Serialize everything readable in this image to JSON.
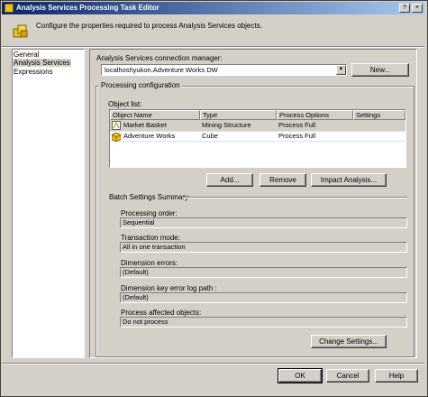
{
  "window": {
    "title": "Analysis Services Processing Task Editor"
  },
  "header": {
    "description": "Configure the properties required to process Analysis Services objects."
  },
  "title_buttons": {
    "help": "?",
    "close": "×"
  },
  "nav": {
    "items": [
      "General",
      "Analysis Services",
      "Expressions"
    ],
    "selected": "Analysis Services"
  },
  "connection": {
    "label": "Analysis Services connection manager:",
    "value": "localhost\\yukon.Adventure Works DW",
    "new_button": "New..."
  },
  "processing": {
    "group_label": "Processing configuration",
    "object_list_label": "Object list:",
    "columns": [
      "Object Name",
      "Type",
      "Process Options",
      "Settings"
    ],
    "rows": [
      {
        "name": "Market Basket",
        "type": "Mining Structure",
        "option": "Process Full",
        "settings": "",
        "icon": "mining-structure-icon"
      },
      {
        "name": "Adventure Works",
        "type": "Cube",
        "option": "Process Full",
        "settings": "",
        "icon": "cube-icon"
      }
    ],
    "add_button": "Add...",
    "remove_button": "Remove",
    "impact_button": "Impact Analysis..."
  },
  "batch": {
    "label": "Batch Settings Summary",
    "fields": [
      {
        "label": "Processing order:",
        "value": "Sequential"
      },
      {
        "label": "Transaction mode:",
        "value": "All in one transaction"
      },
      {
        "label": "Dimension errors:",
        "value": "(Default)"
      },
      {
        "label": "Dimension key error log path :",
        "value": "(Default)"
      },
      {
        "label": "Process affected objects:",
        "value": "Do not process"
      }
    ],
    "change_button": "Change Settings..."
  },
  "footer": {
    "ok": "OK",
    "cancel": "Cancel",
    "help": "Help"
  }
}
